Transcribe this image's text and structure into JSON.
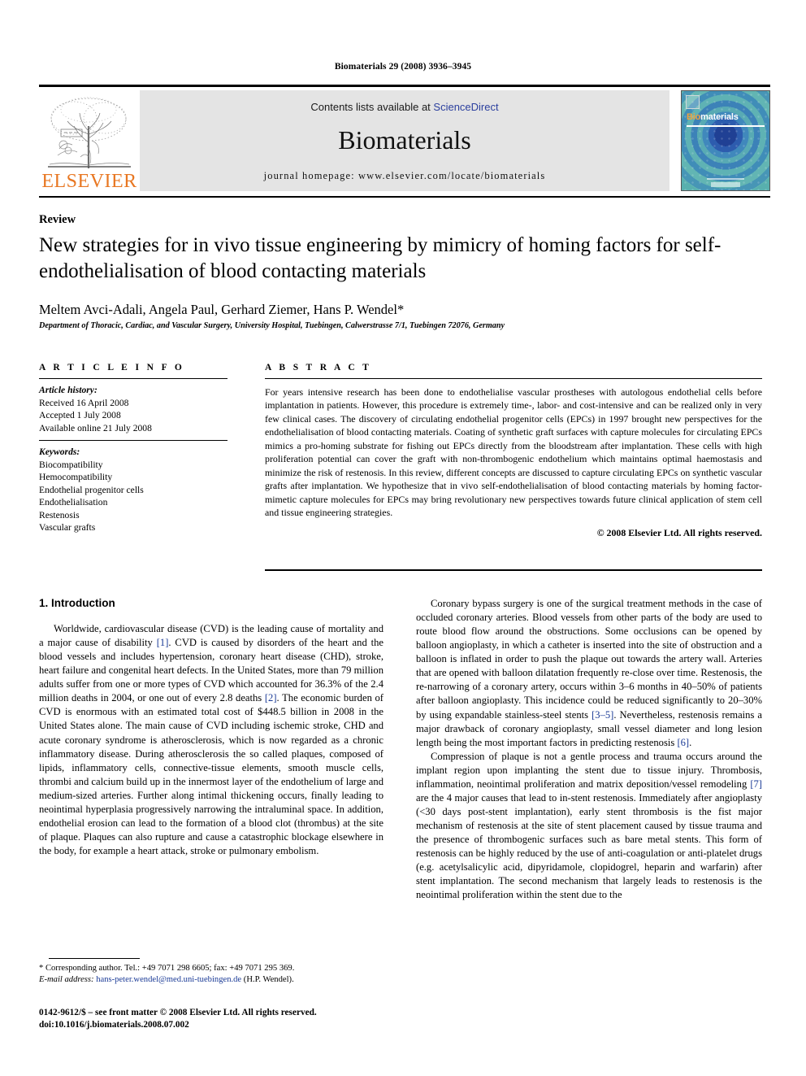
{
  "running_head": "Biomaterials 29 (2008) 3936–3945",
  "masthead": {
    "publisher_name": "ELSEVIER",
    "publisher_logo_alt": "elsevier-tree-logo",
    "contents_prefix": "Contents lists available at ",
    "contents_link": "ScienceDirect",
    "journal_title": "Biomaterials",
    "homepage": "journal homepage: www.elsevier.com/locate/biomaterials",
    "cover": {
      "title_a": "Bio",
      "title_b": "materials"
    }
  },
  "article": {
    "type": "Review",
    "title": "New strategies for in vivo tissue engineering by mimicry of homing factors for self-endothelialisation of blood contacting materials",
    "authors": "Meltem Avci-Adali, Angela Paul, Gerhard Ziemer, Hans P. Wendel*",
    "affiliation": "Department of Thoracic, Cardiac, and Vascular Surgery, University Hospital, Tuebingen, Calwerstrasse 7/1, Tuebingen 72076, Germany"
  },
  "info": {
    "heading": "A R T I C L E    I N F O",
    "history_label": "Article history:",
    "history": [
      "Received 16 April 2008",
      "Accepted 1 July 2008",
      "Available online 21 July 2008"
    ],
    "keywords_label": "Keywords:",
    "keywords": [
      "Biocompatibility",
      "Hemocompatibility",
      "Endothelial progenitor cells",
      "Endothelialisation",
      "Restenosis",
      "Vascular grafts"
    ]
  },
  "abstract": {
    "heading": "A B S T R A C T",
    "text": "For years intensive research has been done to endothelialise vascular prostheses with autologous endothelial cells before implantation in patients. However, this procedure is extremely time-, labor- and cost-intensive and can be realized only in very few clinical cases. The discovery of circulating endothelial progenitor cells (EPCs) in 1997 brought new perspectives for the endothelialisation of blood contacting materials. Coating of synthetic graft surfaces with capture molecules for circulating EPCs mimics a pro-homing substrate for fishing out EPCs directly from the bloodstream after implantation. These cells with high proliferation potential can cover the graft with non-thrombogenic endothelium which maintains optimal haemostasis and minimize the risk of restenosis. In this review, different concepts are discussed to capture circulating EPCs on synthetic vascular grafts after implantation. We hypothesize that in vivo self-endothelialisation of blood contacting materials by homing factor-mimetic capture molecules for EPCs may bring revolutionary new perspectives towards future clinical application of stem cell and tissue engineering strategies.",
    "copyright": "© 2008 Elsevier Ltd. All rights reserved."
  },
  "body": {
    "section_heading": "1. Introduction",
    "left_paragraphs": [
      "Worldwide, cardiovascular disease (CVD) is the leading cause of mortality and a major cause of disability [1]. CVD is caused by disorders of the heart and the blood vessels and includes hypertension, coronary heart disease (CHD), stroke, heart failure and congenital heart defects. In the United States, more than 79 million adults suffer from one or more types of CVD which accounted for 36.3% of the 2.4 million deaths in 2004, or one out of every 2.8 deaths [2]. The economic burden of CVD is enormous with an estimated total cost of $448.5 billion in 2008 in the United States alone. The main cause of CVD including ischemic stroke, CHD and acute coronary syndrome is atherosclerosis, which is now regarded as a chronic inflammatory disease. During atherosclerosis the so called plaques, composed of lipids, inflammatory cells, connective-tissue elements, smooth muscle cells, thrombi and calcium build up in the innermost layer of the endothelium of large and medium-sized arteries. Further along intimal thickening occurs, finally leading to neointimal hyperplasia progressively narrowing the intraluminal space. In addition, endothelial erosion can lead to the formation of a blood clot (thrombus) at the site of plaque. Plaques can also rupture and cause a catastrophic blockage elsewhere in the body, for example a heart attack, stroke or pulmonary embolism."
    ],
    "right_paragraphs": [
      "Coronary bypass surgery is one of the surgical treatment methods in the case of occluded coronary arteries. Blood vessels from other parts of the body are used to route blood flow around the obstructions. Some occlusions can be opened by balloon angioplasty, in which a catheter is inserted into the site of obstruction and a balloon is inflated in order to push the plaque out towards the artery wall. Arteries that are opened with balloon dilatation frequently re-close over time. Restenosis, the re-narrowing of a coronary artery, occurs within 3–6 months in 40–50% of patients after balloon angioplasty. This incidence could be reduced significantly to 20–30% by using expandable stainless-steel stents [3–5]. Nevertheless, restenosis remains a major drawback of coronary angioplasty, small vessel diameter and long lesion length being the most important factors in predicting restenosis [6].",
      "Compression of plaque is not a gentle process and trauma occurs around the implant region upon implanting the stent due to tissue injury. Thrombosis, inflammation, neointimal proliferation and matrix deposition/vessel remodeling [7] are the 4 major causes that lead to in-stent restenosis. Immediately after angioplasty (<30 days post-stent implantation), early stent thrombosis is the fist major mechanism of restenosis at the site of stent placement caused by tissue trauma and the presence of thrombogenic surfaces such as bare metal stents. This form of restenosis can be highly reduced by the use of anti-coagulation or anti-platelet drugs (e.g. acetylsalicylic acid, dipyridamole, clopidogrel, heparin and warfarin) after stent implantation. The second mechanism that largely leads to restenosis is the neointimal proliferation within the stent due to the"
    ]
  },
  "footnote": {
    "corresponding": "* Corresponding author. Tel.: +49 7071 298 6605; fax: +49 7071 295 369.",
    "email_label": "E-mail address:",
    "email": "hans-peter.wendel@med.uni-tuebingen.de",
    "email_owner": "(H.P. Wendel)."
  },
  "imprint": {
    "line1": "0142-9612/$ – see front matter © 2008 Elsevier Ltd. All rights reserved.",
    "line2": "doi:10.1016/j.biomaterials.2008.07.002"
  },
  "colors": {
    "elsevier_orange": "#E87722",
    "link_blue": "#1a3a96",
    "sciencedirect_blue": "#2b3f9e",
    "band_gray": "#e4e4e4"
  }
}
